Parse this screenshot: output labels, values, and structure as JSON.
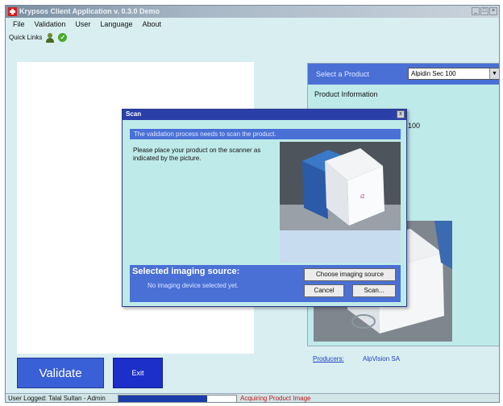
{
  "window": {
    "title": "Krypsos Client Application v. 0.3.0 Demo",
    "controls": [
      "_",
      "□",
      "×"
    ]
  },
  "menu": {
    "items": [
      "File",
      "Validation",
      "User",
      "Language",
      "About"
    ]
  },
  "quicklinks": {
    "label": "Quick Links",
    "icons": [
      "user-icon",
      "check-icon"
    ]
  },
  "product": {
    "select_label": "Select a Product",
    "selected": "Alpidin Sec 100",
    "info_label": "Product Information",
    "info_value": "100",
    "producers_label": "Producers:",
    "producers_value": "AlpVision SA"
  },
  "actions": {
    "validate": "Validate",
    "exit": "Exit"
  },
  "status": {
    "user": "User Logged:  Talal Sultan - Admin",
    "progress_fraction": 0.75,
    "message": "Acquiring Product Image",
    "message_color": "#c01818"
  },
  "dialog": {
    "title": "Scan",
    "close": "x",
    "banner": "The validation process needs to scan the product.",
    "instruction": "Please place your product on the scanner as indicated by the picture.",
    "source_title": "Selected imaging source:",
    "source_status": "No imaging device selected yet.",
    "choose_button": "Choose imaging source",
    "cancel_button": "Cancel",
    "scan_button": "Scan..."
  },
  "colors": {
    "accent": "#4a70d6",
    "panel": "#bfeaea",
    "validate_button": "#3a60d8",
    "exit_button": "#1c2fc8"
  }
}
